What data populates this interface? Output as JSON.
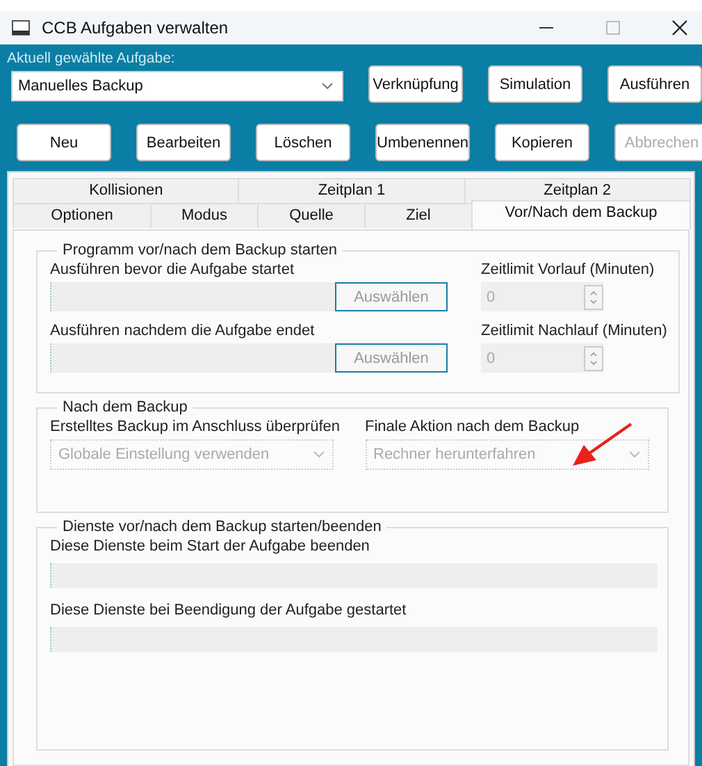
{
  "window": {
    "title": "CCB Aufgaben verwalten"
  },
  "task_selector": {
    "label": "Aktuell gewählte Aufgabe:",
    "value": "Manuelles Backup"
  },
  "top_buttons": [
    {
      "label": "Verknüpfung",
      "disabled": false
    },
    {
      "label": "Simulation",
      "disabled": false
    },
    {
      "label": "Ausführen",
      "disabled": false
    }
  ],
  "action_buttons": [
    {
      "label": "Neu",
      "disabled": false
    },
    {
      "label": "Bearbeiten",
      "disabled": false
    },
    {
      "label": "Löschen",
      "disabled": false
    },
    {
      "label": "Umbenennen",
      "disabled": false
    },
    {
      "label": "Kopieren",
      "disabled": false
    },
    {
      "label": "Abbrechen",
      "disabled": true
    }
  ],
  "tab_rows": [
    [
      {
        "label": "Kollisionen",
        "selected": false
      },
      {
        "label": "Zeitplan 1",
        "selected": false
      },
      {
        "label": "Zeitplan 2",
        "selected": false
      }
    ],
    [
      {
        "label": "Optionen",
        "selected": false
      },
      {
        "label": "Modus",
        "selected": false
      },
      {
        "label": "Quelle",
        "selected": false
      },
      {
        "label": "Ziel",
        "selected": false
      },
      {
        "label": "Vor/Nach dem Backup",
        "selected": true
      }
    ]
  ],
  "groups": [
    {
      "kind": "programs",
      "title": "Programm vor/nach dem Backup starten",
      "rows": [
        {
          "label": "Ausführen bevor die Aufgabe startet",
          "button": "Auswählen",
          "timeout_label": "Zeitlimit Vorlauf (Minuten)",
          "timeout_value": "0",
          "disabled": true
        },
        {
          "label": "Ausführen nachdem die Aufgabe endet",
          "button": "Auswählen",
          "timeout_label": "Zeitlimit Nachlauf (Minuten)",
          "timeout_value": "0",
          "disabled": true
        }
      ]
    },
    {
      "kind": "selects",
      "title": "Nach dem Backup",
      "selects": [
        {
          "label": "Erstelltes Backup im Anschluss überprüfen",
          "value": "Globale Einstellung verwenden",
          "disabled": true
        },
        {
          "label": "Finale Aktion nach dem Backup",
          "value": "Rechner herunterfahren",
          "disabled": true
        }
      ]
    },
    {
      "kind": "services",
      "title": "Dienste vor/nach dem Backup starten/beenden",
      "fields": [
        {
          "label": "Diese Dienste beim Start der Aufgabe beenden",
          "disabled": true
        },
        {
          "label": "Diese Dienste bei Beendigung der Aufgabe gestartet",
          "disabled": true
        }
      ]
    }
  ]
}
